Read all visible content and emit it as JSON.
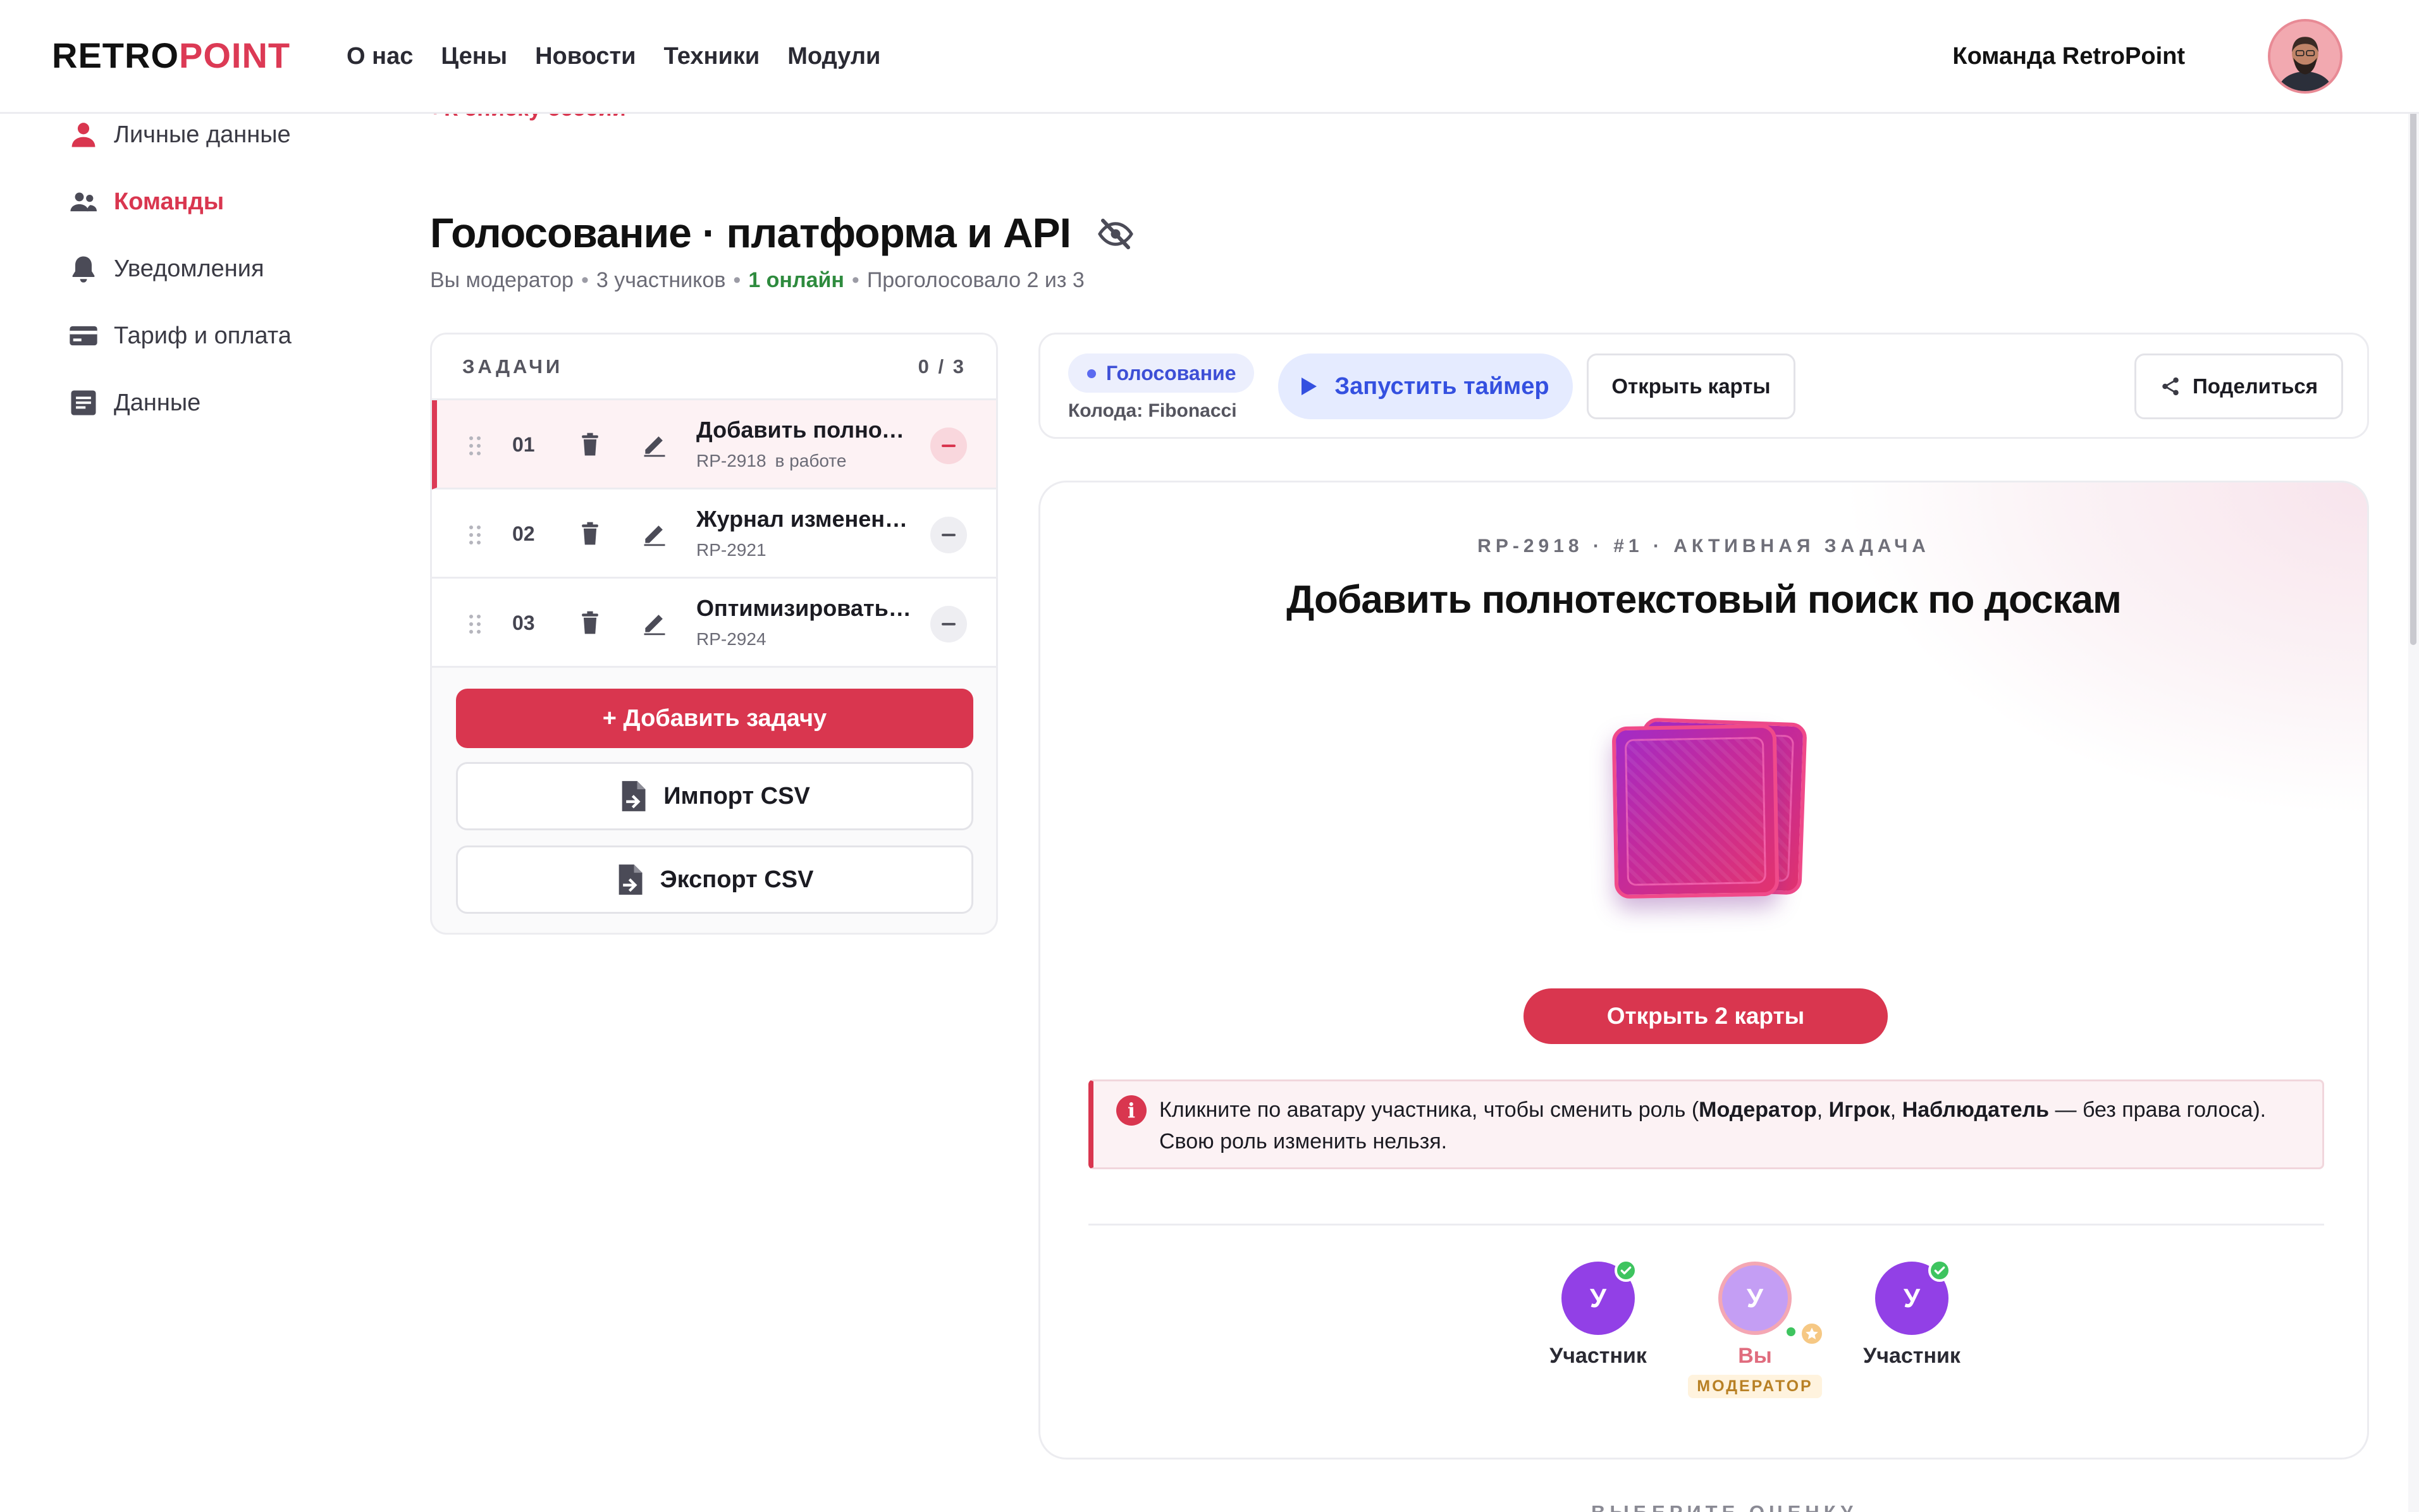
{
  "header": {
    "logo_part1": "RETRO",
    "logo_part2": "POINT",
    "nav": [
      "О нас",
      "Цены",
      "Новости",
      "Техники",
      "Модули"
    ],
    "team_name": "Команда RetroPoint"
  },
  "sidebar": {
    "items": [
      {
        "label": "Личные данные",
        "icon": "person-icon"
      },
      {
        "label": "Команды",
        "icon": "people-icon",
        "active": true
      },
      {
        "label": "Уведомления",
        "icon": "bell-icon"
      },
      {
        "label": "Тариф и оплата",
        "icon": "credit-card-icon"
      },
      {
        "label": "Данные",
        "icon": "document-icon"
      }
    ]
  },
  "page": {
    "back_link": "‹ К списку сессий",
    "title": "Голосование · платформа и API",
    "subtitle": {
      "role": "Вы модератор",
      "participants": "3 участников",
      "online": "1 онлайн",
      "voted": "Проголосовало 2 из 3"
    }
  },
  "tasks": {
    "title": "ЗАДАЧИ",
    "count": "0 / 3",
    "items": [
      {
        "num": "01",
        "name": "Добавить полнотекстовый поиск по доскам",
        "key": "RP-2918",
        "status": "в работе",
        "active": true
      },
      {
        "num": "02",
        "name": "Журнал изменений",
        "key": "RP-2921",
        "status": ""
      },
      {
        "num": "03",
        "name": "Оптимизировать загрузку",
        "key": "RP-2924",
        "status": ""
      }
    ],
    "add_button": "+ Добавить задачу",
    "import_button": "Импорт CSV",
    "export_button": "Экспорт CSV"
  },
  "toolbar": {
    "phase": "Голосование",
    "deck": "Колода: Fibonacci",
    "timer_button": "Запустить таймер",
    "open_cards_button": "Открыть карты",
    "share_button": "Поделиться"
  },
  "vote": {
    "eyebrow": "RP-2918 · #1 · АКТИВНАЯ ЗАДАЧА",
    "title": "Добавить полнотекстовый поиск по доскам",
    "reveal_button": "Открыть 2 карты",
    "info": {
      "part1": "Кликните по аватару участника, чтобы сменить роль (",
      "role1": "Модератор",
      "sep1": ", ",
      "role2": "Игрок",
      "sep2": ", ",
      "role3": "Наблюдатель",
      "part2": " — без права голоса). Свою роль изменить нельзя."
    },
    "participants": [
      {
        "initial": "У",
        "name": "Участник",
        "voted": true
      },
      {
        "initial": "У",
        "name": "Вы",
        "role": "МОДЕРАТОР",
        "self": true
      },
      {
        "initial": "У",
        "name": "Участник",
        "voted": true
      }
    ],
    "next_section": "ВЫБЕРИТЕ ОЦЕНКУ"
  },
  "colors": {
    "accent": "#d9364f",
    "timer": "#3450e0",
    "online": "#2e8b3e",
    "avatar": "#9240e6"
  }
}
